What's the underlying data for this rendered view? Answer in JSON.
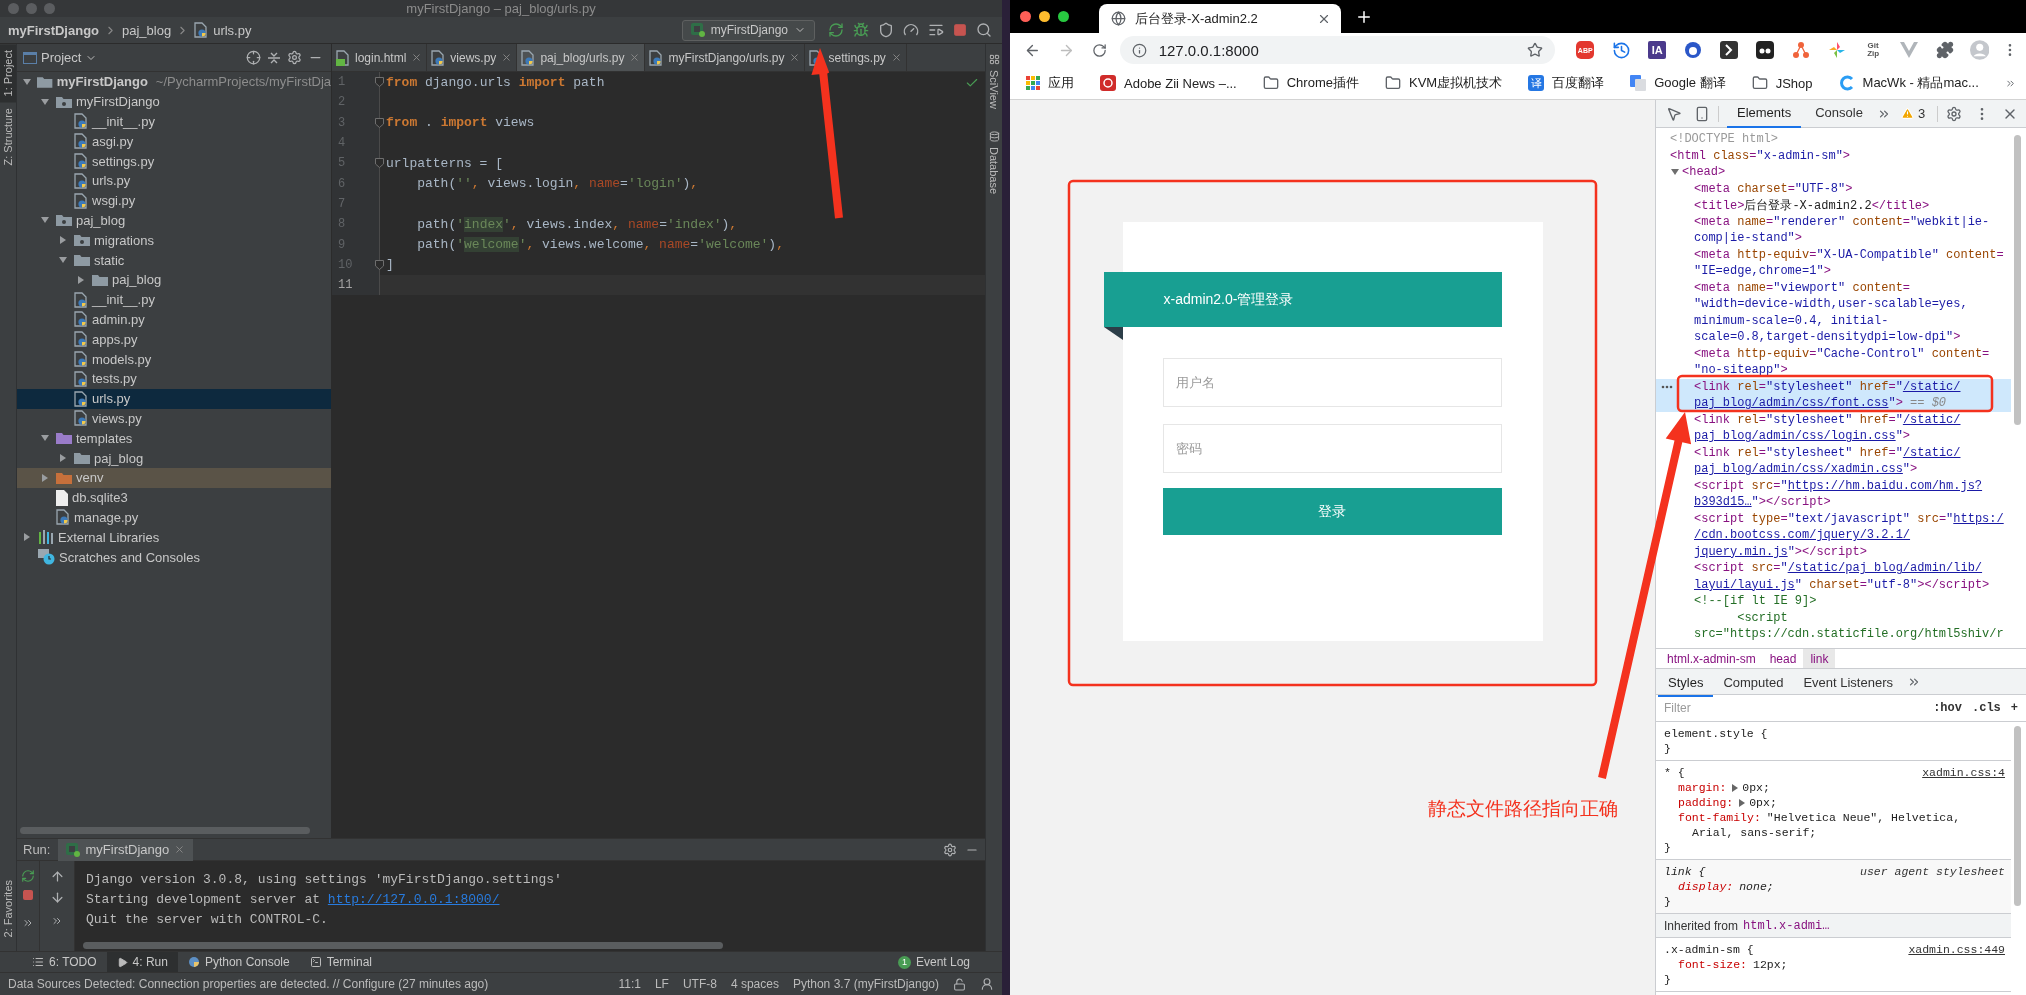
{
  "ide": {
    "title": "myFirstDjango – paj_blog/urls.py",
    "breadcrumbs": [
      {
        "label": "myFirstDjango",
        "kind": "none"
      },
      {
        "label": "paj_blog",
        "kind": "none"
      },
      {
        "label": "urls.py",
        "kind": "py"
      }
    ],
    "run_config": "myFirstDjango",
    "tool_strip": [
      {
        "label": "1: Project",
        "selected": true
      },
      {
        "label": "Z: Structure",
        "selected": false
      }
    ],
    "favorites_label": "2: Favorites",
    "project": {
      "title": "Project",
      "tree": [
        {
          "label": "myFirstDjango",
          "path": "~/PycharmProjects/myFirstDja",
          "kind": "folder",
          "expanded": true,
          "selected": false,
          "children": [
            {
              "label": "myFirstDjango",
              "kind": "package",
              "expanded": true,
              "selected": false,
              "children": [
                {
                  "label": "__init__.py",
                  "kind": "py",
                  "selected": false
                },
                {
                  "label": "asgi.py",
                  "kind": "py",
                  "selected": false
                },
                {
                  "label": "settings.py",
                  "kind": "py",
                  "selected": false
                },
                {
                  "label": "urls.py",
                  "kind": "py",
                  "selected": false
                },
                {
                  "label": "wsgi.py",
                  "kind": "py",
                  "selected": false
                }
              ]
            },
            {
              "label": "paj_blog",
              "kind": "package",
              "expanded": true,
              "selected": false,
              "children": [
                {
                  "label": "migrations",
                  "kind": "package",
                  "expanded": false,
                  "selected": false
                },
                {
                  "label": "static",
                  "kind": "folder",
                  "expanded": true,
                  "selected": false,
                  "children": [
                    {
                      "label": "paj_blog",
                      "kind": "folder",
                      "expanded": false,
                      "selected": false
                    }
                  ]
                },
                {
                  "label": "__init__.py",
                  "kind": "py",
                  "selected": false
                },
                {
                  "label": "admin.py",
                  "kind": "py",
                  "selected": false
                },
                {
                  "label": "apps.py",
                  "kind": "py",
                  "selected": false
                },
                {
                  "label": "models.py",
                  "kind": "py",
                  "selected": false
                },
                {
                  "label": "tests.py",
                  "kind": "py",
                  "selected": false
                },
                {
                  "label": "urls.py",
                  "kind": "py",
                  "selected": true
                },
                {
                  "label": "views.py",
                  "kind": "py",
                  "selected": false
                }
              ]
            },
            {
              "label": "templates",
              "kind": "templates",
              "expanded": true,
              "selected": false,
              "children": [
                {
                  "label": "paj_blog",
                  "kind": "folder",
                  "expanded": false,
                  "selected": false
                }
              ]
            },
            {
              "label": "venv",
              "kind": "excluded",
              "expanded": false,
              "selected": false
            },
            {
              "label": "db.sqlite3",
              "kind": "file",
              "selected": false
            },
            {
              "label": "manage.py",
              "kind": "py",
              "selected": false
            }
          ]
        },
        {
          "label": "External Libraries",
          "kind": "lib",
          "expanded": false,
          "selected": false
        },
        {
          "label": "Scratches and Consoles",
          "kind": "scratch",
          "selected": false
        }
      ]
    },
    "tabs": [
      {
        "label": "login.html",
        "kind": "html",
        "selected": false
      },
      {
        "label": "views.py",
        "kind": "py",
        "selected": false
      },
      {
        "label": "paj_blog/urls.py",
        "kind": "py",
        "selected": true
      },
      {
        "label": "myFirstDjango/urls.py",
        "kind": "py",
        "selected": false
      },
      {
        "label": "settings.py",
        "kind": "py",
        "selected": false
      }
    ],
    "side_tools": [
      {
        "label": "SciView",
        "kind": "grid"
      },
      {
        "label": "Database",
        "kind": "db"
      }
    ],
    "code_lines": [
      {
        "number": "1",
        "fold": true,
        "current": false,
        "tokens": [
          {
            "kind": "kw",
            "text": "from"
          },
          {
            "kind": "p",
            "text": " django.urls "
          },
          {
            "kind": "kw",
            "text": "import"
          },
          {
            "kind": "p",
            "text": " path"
          }
        ]
      },
      {
        "number": "2",
        "fold": false,
        "current": false
      },
      {
        "number": "3",
        "fold": true,
        "current": false,
        "tokens": [
          {
            "kind": "kw",
            "text": "from"
          },
          {
            "kind": "p",
            "text": " . "
          },
          {
            "kind": "kw",
            "text": "import"
          },
          {
            "kind": "p",
            "text": " views"
          }
        ]
      },
      {
        "number": "4",
        "fold": false,
        "current": false
      },
      {
        "number": "5",
        "fold": true,
        "current": false,
        "tokens": [
          {
            "kind": "p",
            "text": "urlpatterns = ["
          }
        ]
      },
      {
        "number": "6",
        "fold": false,
        "current": false,
        "tokens": [
          {
            "kind": "p",
            "text": "    path("
          },
          {
            "kind": "s",
            "text": "''"
          },
          {
            "kind": "o",
            "text": ","
          },
          {
            "kind": "p",
            "text": " views.login"
          },
          {
            "kind": "o",
            "text": ","
          },
          {
            "kind": "n",
            "text": " name"
          },
          {
            "kind": "p",
            "text": "="
          },
          {
            "kind": "s",
            "text": "'login'"
          },
          {
            "kind": "p",
            "text": ")"
          },
          {
            "kind": "o",
            "text": ","
          }
        ]
      },
      {
        "number": "7",
        "fold": false,
        "current": false
      },
      {
        "number": "8",
        "fold": false,
        "current": false,
        "tokens": [
          {
            "kind": "p",
            "text": "    path("
          },
          {
            "kind": "s",
            "text": "'"
          },
          {
            "kind": "h",
            "text": "index"
          },
          {
            "kind": "s",
            "text": "'"
          },
          {
            "kind": "o",
            "text": ","
          },
          {
            "kind": "p",
            "text": " views.index"
          },
          {
            "kind": "o",
            "text": ","
          },
          {
            "kind": "n",
            "text": " name"
          },
          {
            "kind": "p",
            "text": "="
          },
          {
            "kind": "s",
            "text": "'index'"
          },
          {
            "kind": "p",
            "text": ")"
          },
          {
            "kind": "o",
            "text": ","
          }
        ]
      },
      {
        "number": "9",
        "fold": false,
        "current": false,
        "tokens": [
          {
            "kind": "p",
            "text": "    path("
          },
          {
            "kind": "s",
            "text": "'"
          },
          {
            "kind": "h",
            "text": "welcome"
          },
          {
            "kind": "s",
            "text": "'"
          },
          {
            "kind": "o",
            "text": ","
          },
          {
            "kind": "p",
            "text": " views.welcome"
          },
          {
            "kind": "o",
            "text": ","
          },
          {
            "kind": "n",
            "text": " name"
          },
          {
            "kind": "p",
            "text": "="
          },
          {
            "kind": "s",
            "text": "'welcome'"
          },
          {
            "kind": "p",
            "text": ")"
          },
          {
            "kind": "o",
            "text": ","
          }
        ]
      },
      {
        "number": "10",
        "fold": true,
        "current": false,
        "tokens": [
          {
            "kind": "p",
            "text": "]"
          }
        ]
      },
      {
        "number": "11",
        "fold": false,
        "current": true
      }
    ],
    "run": {
      "label": "Run:",
      "tab": "myFirstDjango",
      "console": [
        [
          {
            "kind": "p",
            "text": "Django version 3.0.8, using settings 'myFirstDjango.settings'"
          }
        ],
        [
          {
            "kind": "p",
            "text": "Starting development server at "
          },
          {
            "kind": "link",
            "text": "http://127.0.0.1:8000/"
          }
        ],
        [
          {
            "kind": "p",
            "text": "Quit the server with CONTROL-C."
          }
        ]
      ]
    },
    "bottom_tabs": [
      {
        "label": "6: TODO",
        "kind": "list",
        "selected": false
      },
      {
        "label": "4: Run",
        "kind": "run",
        "selected": true
      },
      {
        "label": "Python Console",
        "kind": "python",
        "selected": false
      },
      {
        "label": "Terminal",
        "kind": "terminal",
        "selected": false
      }
    ],
    "event_log": {
      "count": "1",
      "label": "Event Log"
    },
    "status": {
      "message": "Data Sources Detected: Connection properties are detected. // Configure (27 minutes ago)",
      "items": [
        "11:1",
        "LF",
        "UTF-8",
        "4 spaces",
        "Python 3.7 (myFirstDjango)"
      ]
    }
  },
  "browser": {
    "tab_title": "后台登录-X-admin2.2",
    "url": "127.0.0.1:8000",
    "extensions": [
      {
        "kind": "abp",
        "label": "ABP"
      },
      {
        "kind": "history"
      },
      {
        "kind": "ia",
        "label": "IA"
      },
      {
        "kind": "octo"
      },
      {
        "kind": "bracket"
      },
      {
        "kind": "dots"
      },
      {
        "kind": "network"
      },
      {
        "kind": "pinwheel"
      },
      {
        "kind": "gitzip",
        "lines": [
          "Git",
          "Zip"
        ]
      },
      {
        "kind": "vee"
      },
      {
        "kind": "puzzle"
      }
    ],
    "bookmarks": [
      {
        "kind": "apps",
        "label": "应用"
      },
      {
        "kind": "adobe",
        "label": "Adobe Zii News –..."
      },
      {
        "kind": "folder",
        "label": "Chrome插件"
      },
      {
        "kind": "folder",
        "label": "KVM虚拟机技术"
      },
      {
        "kind": "translate",
        "badge": "译",
        "label": "百度翻译"
      },
      {
        "kind": "gtranslate",
        "label": "Google 翻译"
      },
      {
        "kind": "folder",
        "label": "JShop"
      },
      {
        "kind": "macwk",
        "label": "MacWk - 精品mac..."
      }
    ],
    "page": {
      "header": "x-admin2.0-管理登录",
      "username_placeholder": "用户名",
      "password_placeholder": "密码",
      "button": "登录"
    },
    "devtools": {
      "tabs": [
        {
          "label": "Elements",
          "selected": true
        },
        {
          "label": "Console",
          "selected": false
        }
      ],
      "warnings": "3",
      "dom": [
        {
          "selected": false,
          "lines": [
            [
              {
                "kind": "d",
                "text": "<!DOCTYPE html>"
              }
            ]
          ]
        },
        {
          "selected": false,
          "lines": [
            [
              {
                "kind": "t",
                "text": "<html"
              },
              {
                "kind": "a",
                "text": " class"
              },
              {
                "kind": "t",
                "text": "="
              },
              {
                "kind": "v",
                "text": "\"x-admin-sm\""
              },
              {
                "kind": "t",
                "text": ">"
              }
            ]
          ],
          "children": [
            {
              "selected": false,
              "expanded": true,
              "lines": [
                [
                  {
                    "kind": "t",
                    "text": "<head>"
                  }
                ]
              ],
              "children": [
                {
                  "selected": false,
                  "lines": [
                    [
                      {
                        "kind": "t",
                        "text": "<meta"
                      },
                      {
                        "kind": "a",
                        "text": " charset"
                      },
                      {
                        "kind": "t",
                        "text": "="
                      },
                      {
                        "kind": "v",
                        "text": "\"UTF-8\""
                      },
                      {
                        "kind": "t",
                        "text": ">"
                      }
                    ]
                  ]
                },
                {
                  "selected": false,
                  "lines": [
                    [
                      {
                        "kind": "t",
                        "text": "<title>"
                      },
                      {
                        "kind": "x",
                        "text": "后台登录-X-admin2.2"
                      },
                      {
                        "kind": "t",
                        "text": "</title>"
                      }
                    ]
                  ]
                },
                {
                  "selected": false,
                  "lines": [
                    [
                      {
                        "kind": "t",
                        "text": "<meta"
                      },
                      {
                        "kind": "a",
                        "text": " name"
                      },
                      {
                        "kind": "t",
                        "text": "="
                      },
                      {
                        "kind": "v",
                        "text": "\"renderer\""
                      },
                      {
                        "kind": "a",
                        "text": " content"
                      },
                      {
                        "kind": "t",
                        "text": "="
                      },
                      {
                        "kind": "v",
                        "text": "\"webkit|ie-"
                      }
                    ],
                    [
                      {
                        "kind": "v",
                        "text": "comp|ie-stand\""
                      },
                      {
                        "kind": "t",
                        "text": ">"
                      }
                    ]
                  ]
                },
                {
                  "selected": false,
                  "lines": [
                    [
                      {
                        "kind": "t",
                        "text": "<meta"
                      },
                      {
                        "kind": "a",
                        "text": " http-equiv"
                      },
                      {
                        "kind": "t",
                        "text": "="
                      },
                      {
                        "kind": "v",
                        "text": "\"X-UA-Compatible\""
                      },
                      {
                        "kind": "a",
                        "text": " content"
                      },
                      {
                        "kind": "t",
                        "text": "="
                      }
                    ],
                    [
                      {
                        "kind": "v",
                        "text": "\"IE=edge,chrome=1\""
                      },
                      {
                        "kind": "t",
                        "text": ">"
                      }
                    ]
                  ]
                },
                {
                  "selected": false,
                  "lines": [
                    [
                      {
                        "kind": "t",
                        "text": "<meta"
                      },
                      {
                        "kind": "a",
                        "text": " name"
                      },
                      {
                        "kind": "t",
                        "text": "="
                      },
                      {
                        "kind": "v",
                        "text": "\"viewport\""
                      },
                      {
                        "kind": "a",
                        "text": " content"
                      },
                      {
                        "kind": "t",
                        "text": "="
                      }
                    ],
                    [
                      {
                        "kind": "v",
                        "text": "\"width=device-width,user-scalable=yes,"
                      }
                    ],
                    [
                      {
                        "kind": "v",
                        "text": "minimum-scale=0.4, initial-"
                      }
                    ],
                    [
                      {
                        "kind": "v",
                        "text": "scale=0.8,target-densitydpi=low-dpi\""
                      },
                      {
                        "kind": "t",
                        "text": ">"
                      }
                    ]
                  ]
                },
                {
                  "selected": false,
                  "lines": [
                    [
                      {
                        "kind": "t",
                        "text": "<meta"
                      },
                      {
                        "kind": "a",
                        "text": " http-equiv"
                      },
                      {
                        "kind": "t",
                        "text": "="
                      },
                      {
                        "kind": "v",
                        "text": "\"Cache-Control\""
                      },
                      {
                        "kind": "a",
                        "text": " content"
                      },
                      {
                        "kind": "t",
                        "text": "="
                      }
                    ],
                    [
                      {
                        "kind": "v",
                        "text": "\"no-siteapp\""
                      },
                      {
                        "kind": "t",
                        "text": ">"
                      }
                    ]
                  ]
                },
                {
                  "selected": true,
                  "lines": [
                    [
                      {
                        "kind": "t",
                        "text": "<link"
                      },
                      {
                        "kind": "a",
                        "text": " rel"
                      },
                      {
                        "kind": "t",
                        "text": "="
                      },
                      {
                        "kind": "v",
                        "text": "\"stylesheet\""
                      },
                      {
                        "kind": "a",
                        "text": " href"
                      },
                      {
                        "kind": "t",
                        "text": "="
                      },
                      {
                        "kind": "v",
                        "text": "\""
                      },
                      {
                        "kind": "l",
                        "text": "/static/"
                      }
                    ],
                    [
                      {
                        "kind": "l",
                        "text": "paj_blog/admin/css/font.css"
                      },
                      {
                        "kind": "v",
                        "text": "\""
                      },
                      {
                        "kind": "t",
                        "text": ">"
                      },
                      {
                        "kind": "g",
                        "text": " == $0"
                      }
                    ]
                  ]
                },
                {
                  "selected": false,
                  "lines": [
                    [
                      {
                        "kind": "t",
                        "text": "<link"
                      },
                      {
                        "kind": "a",
                        "text": " rel"
                      },
                      {
                        "kind": "t",
                        "text": "="
                      },
                      {
                        "kind": "v",
                        "text": "\"stylesheet\""
                      },
                      {
                        "kind": "a",
                        "text": " href"
                      },
                      {
                        "kind": "t",
                        "text": "="
                      },
                      {
                        "kind": "v",
                        "text": "\""
                      },
                      {
                        "kind": "l",
                        "text": "/static/"
                      }
                    ],
                    [
                      {
                        "kind": "l",
                        "text": "paj_blog/admin/css/login.css"
                      },
                      {
                        "kind": "v",
                        "text": "\""
                      },
                      {
                        "kind": "t",
                        "text": ">"
                      }
                    ]
                  ]
                },
                {
                  "selected": false,
                  "lines": [
                    [
                      {
                        "kind": "t",
                        "text": "<link"
                      },
                      {
                        "kind": "a",
                        "text": " rel"
                      },
                      {
                        "kind": "t",
                        "text": "="
                      },
                      {
                        "kind": "v",
                        "text": "\"stylesheet\""
                      },
                      {
                        "kind": "a",
                        "text": " href"
                      },
                      {
                        "kind": "t",
                        "text": "="
                      },
                      {
                        "kind": "v",
                        "text": "\""
                      },
                      {
                        "kind": "l",
                        "text": "/static/"
                      }
                    ],
                    [
                      {
                        "kind": "l",
                        "text": "paj_blog/admin/css/xadmin.css"
                      },
                      {
                        "kind": "v",
                        "text": "\""
                      },
                      {
                        "kind": "t",
                        "text": ">"
                      }
                    ]
                  ]
                },
                {
                  "selected": false,
                  "lines": [
                    [
                      {
                        "kind": "t",
                        "text": "<script"
                      },
                      {
                        "kind": "a",
                        "text": " src"
                      },
                      {
                        "kind": "t",
                        "text": "="
                      },
                      {
                        "kind": "v",
                        "text": "\""
                      },
                      {
                        "kind": "l",
                        "text": "https://hm.baidu.com/hm.js?"
                      }
                    ],
                    [
                      {
                        "kind": "l",
                        "text": "b393d15…"
                      },
                      {
                        "kind": "v",
                        "text": "\""
                      },
                      {
                        "kind": "t",
                        "text": "></script>"
                      }
                    ]
                  ]
                },
                {
                  "selected": false,
                  "lines": [
                    [
                      {
                        "kind": "t",
                        "text": "<script"
                      },
                      {
                        "kind": "a",
                        "text": " type"
                      },
                      {
                        "kind": "t",
                        "text": "="
                      },
                      {
                        "kind": "v",
                        "text": "\"text/javascript\""
                      },
                      {
                        "kind": "a",
                        "text": " src"
                      },
                      {
                        "kind": "t",
                        "text": "="
                      },
                      {
                        "kind": "v",
                        "text": "\""
                      },
                      {
                        "kind": "l",
                        "text": "https:/"
                      }
                    ],
                    [
                      {
                        "kind": "l",
                        "text": "/cdn.bootcss.com/jquery/3.2.1/"
                      }
                    ],
                    [
                      {
                        "kind": "l",
                        "text": "jquery.min.js"
                      },
                      {
                        "kind": "v",
                        "text": "\""
                      },
                      {
                        "kind": "t",
                        "text": "></script>"
                      }
                    ]
                  ]
                },
                {
                  "selected": false,
                  "lines": [
                    [
                      {
                        "kind": "t",
                        "text": "<script"
                      },
                      {
                        "kind": "a",
                        "text": " src"
                      },
                      {
                        "kind": "t",
                        "text": "="
                      },
                      {
                        "kind": "v",
                        "text": "\""
                      },
                      {
                        "kind": "l",
                        "text": "/static/paj_blog/admin/lib/"
                      }
                    ],
                    [
                      {
                        "kind": "l",
                        "text": "layui/layui.js"
                      },
                      {
                        "kind": "v",
                        "text": "\""
                      },
                      {
                        "kind": "a",
                        "text": " charset"
                      },
                      {
                        "kind": "t",
                        "text": "="
                      },
                      {
                        "kind": "v",
                        "text": "\"utf-8\""
                      },
                      {
                        "kind": "t",
                        "text": "></script>"
                      }
                    ]
                  ]
                },
                {
                  "selected": false,
                  "lines": [
                    [
                      {
                        "kind": "c",
                        "text": "<!--[if lt IE 9]>"
                      }
                    ],
                    [
                      {
                        "kind": "c",
                        "text": "      <script"
                      }
                    ],
                    [
                      {
                        "kind": "c",
                        "text": "src=\"https://cdn.staticfile.org/html5shiv/r"
                      }
                    ]
                  ]
                }
              ]
            }
          ]
        }
      ],
      "breadcrumbs": [
        {
          "label": "html.x-admin-sm",
          "selected": false
        },
        {
          "label": "head",
          "selected": false
        },
        {
          "label": "link",
          "selected": true
        }
      ],
      "style_tabs": [
        {
          "label": "Styles",
          "selected": true
        },
        {
          "label": "Computed",
          "selected": false
        },
        {
          "label": "Event Listeners",
          "selected": false
        }
      ],
      "filter": {
        "placeholder": "Filter",
        "buttons": [
          ":hov",
          ".cls",
          "+"
        ]
      },
      "rules": [
        {
          "kind": "rule",
          "selector": "element.style {",
          "close": "}"
        },
        {
          "kind": "rule",
          "selector": "* {",
          "source": "xadmin.css:4",
          "decls": [
            {
              "name": "margin:",
              "value": [
                "0px;"
              ],
              "expandable": true
            },
            {
              "name": "padding:",
              "value": [
                "0px;"
              ],
              "expandable": true
            },
            {
              "name": "font-family:",
              "value": [
                "\"Helvetica Neue\", Helvetica,",
                "Arial, sans-serif;"
              ],
              "expandable": false
            }
          ],
          "close": "}"
        },
        {
          "kind": "ua_rule",
          "selector": "link {",
          "source": "user agent stylesheet",
          "decls": [
            {
              "name": "display:",
              "value": [
                "none;"
              ],
              "expandable": false
            }
          ],
          "close": "}"
        },
        {
          "kind": "inherited",
          "label": "Inherited from",
          "target": "html.x-admi…"
        },
        {
          "kind": "rule",
          "selector": ".x-admin-sm {",
          "source": "xadmin.css:449",
          "decls": [
            {
              "name": "font-size:",
              "value": [
                "12px;"
              ],
              "expandable": false
            }
          ],
          "close": "}"
        }
      ]
    }
  },
  "annotation": "静态文件路径指向正确"
}
